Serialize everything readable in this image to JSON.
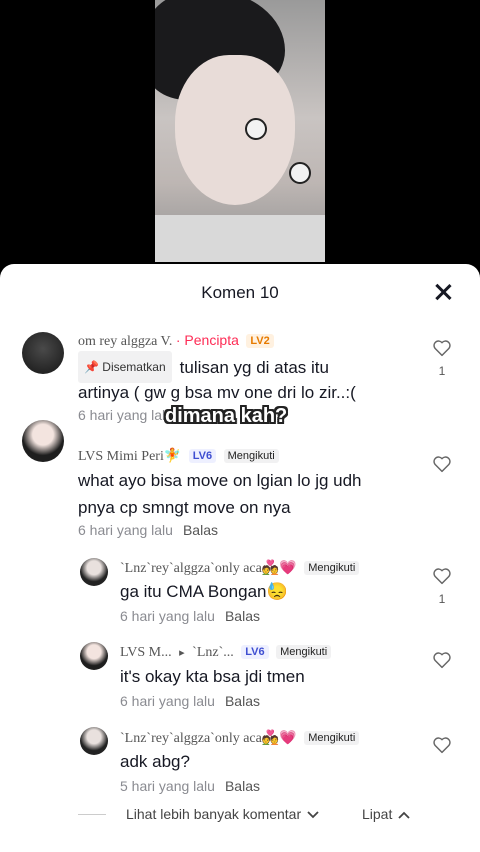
{
  "header": {
    "title": "Komen 10"
  },
  "caption_overlay": "dimana kah?",
  "comments": [
    {
      "name": "om rey alggza V.",
      "creator_label": "· Pencipta",
      "level": "LV2",
      "pinned_label": "Disematkan",
      "text_line1": "tulisan yg di atas itu",
      "text_line2": "artinya ( gw g bsa mv one dri lo zir..:(",
      "time": "6 hari yang lalu",
      "reply": "Balas",
      "likes": "1"
    },
    {
      "name": "LVS Mimi Peri🧚",
      "level": "LV6",
      "follow": "Mengikuti",
      "text_line1": "what ayo bisa move on lgian lo jg udh",
      "text_line2": "pnya cp smngt move on nya",
      "time": "6 hari yang lalu",
      "reply": "Balas"
    }
  ],
  "replies": [
    {
      "name": "`Lnz`rey`alggza`only aca💑💗",
      "follow": "Mengikuti",
      "text": "ga itu CMA Bongan😓",
      "time": "6 hari yang lalu",
      "reply": "Balas",
      "likes": "1"
    },
    {
      "name": "LVS M...",
      "arrow": "▸",
      "reply_to": "`Lnz`...",
      "level": "LV6",
      "follow": "Mengikuti",
      "text": "it's okay kta bsa jdi tmen",
      "time": "6 hari yang lalu",
      "reply": "Balas"
    },
    {
      "name": "`Lnz`rey`alggza`only aca💑💗",
      "follow": "Mengikuti",
      "text": "adk abg?",
      "time": "5 hari yang lalu",
      "reply": "Balas"
    }
  ],
  "footer": {
    "more_label": "Lihat lebih banyak komentar",
    "collapse_label": "Lipat"
  }
}
